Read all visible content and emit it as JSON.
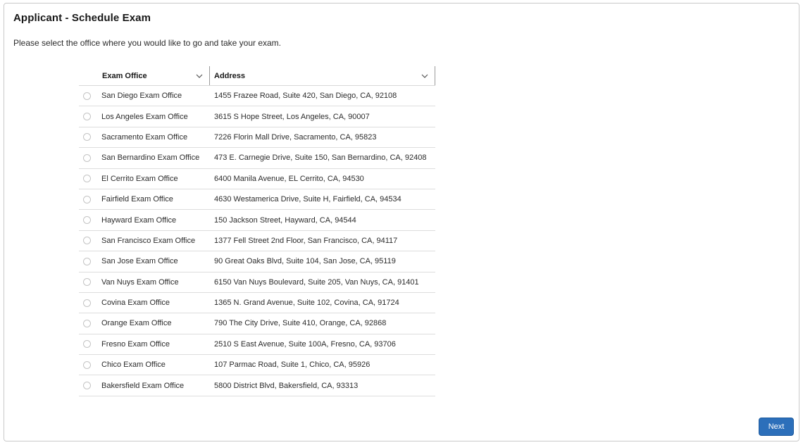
{
  "page": {
    "title": "Applicant - Schedule Exam",
    "instructions": "Please select the office where you would like to go and take your exam."
  },
  "table": {
    "columns": {
      "office": "Exam Office",
      "address": "Address"
    },
    "rows": [
      {
        "office": "San Diego Exam Office",
        "address": "1455 Frazee Road, Suite 420, San Diego, CA, 92108"
      },
      {
        "office": "Los Angeles Exam Office",
        "address": "3615 S Hope Street, Los Angeles, CA, 90007"
      },
      {
        "office": "Sacramento Exam Office",
        "address": "7226 Florin Mall Drive, Sacramento, CA, 95823"
      },
      {
        "office": "San Bernardino Exam Office",
        "address": "473 E. Carnegie Drive, Suite 150, San Bernardino, CA, 92408"
      },
      {
        "office": "El Cerrito Exam Office",
        "address": "6400 Manila Avenue, EL Cerrito, CA, 94530"
      },
      {
        "office": "Fairfield Exam Office",
        "address": "4630 Westamerica Drive, Suite H, Fairfield, CA, 94534"
      },
      {
        "office": "Hayward Exam Office",
        "address": "150 Jackson Street, Hayward, CA, 94544"
      },
      {
        "office": "San Francisco Exam Office",
        "address": "1377 Fell Street 2nd Floor, San Francisco, CA, 94117"
      },
      {
        "office": "San Jose Exam Office",
        "address": "90 Great Oaks Blvd, Suite 104, San Jose, CA, 95119"
      },
      {
        "office": "Van Nuys Exam Office",
        "address": "6150 Van Nuys Boulevard, Suite 205, Van Nuys, CA, 91401"
      },
      {
        "office": "Covina Exam Office",
        "address": "1365 N. Grand Avenue, Suite 102, Covina, CA, 91724"
      },
      {
        "office": "Orange Exam Office",
        "address": "790 The City Drive, Suite 410, Orange, CA, 92868"
      },
      {
        "office": "Fresno Exam Office",
        "address": "2510 S East Avenue, Suite 100A, Fresno, CA, 93706"
      },
      {
        "office": "Chico Exam Office",
        "address": "107 Parmac Road, Suite 1, Chico, CA, 95926"
      },
      {
        "office": "Bakersfield Exam Office",
        "address": "5800 District Blvd, Bakersfield, CA, 93313"
      }
    ]
  },
  "actions": {
    "next_label": "Next"
  },
  "icons": {
    "sort": "chevron-down-icon",
    "select": "radio-icon"
  },
  "colors": {
    "primary_button": "#2c6fba",
    "border": "#c9c9c9"
  }
}
